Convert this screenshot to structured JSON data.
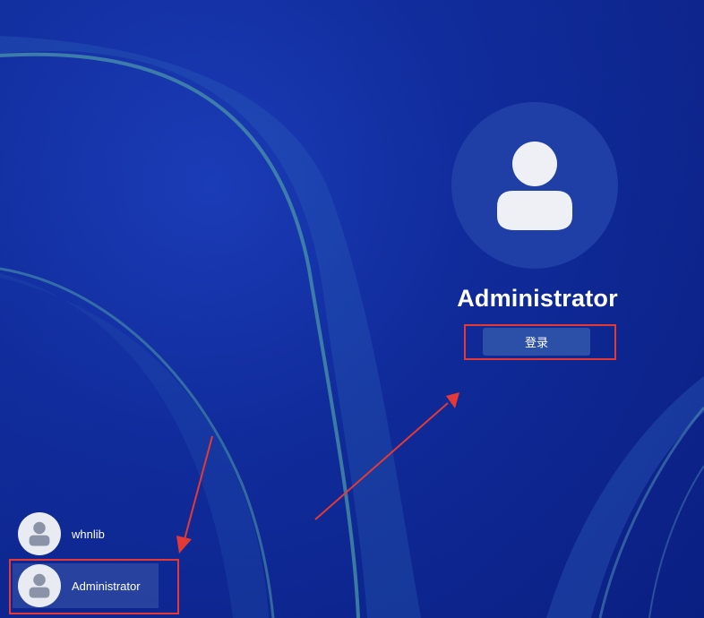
{
  "main_user": {
    "name": "Administrator",
    "login_button_label": "登录"
  },
  "user_list": [
    {
      "name": "whnlib"
    },
    {
      "name": "Administrator",
      "selected": true
    }
  ],
  "icons": {
    "main_avatar": "person-icon",
    "user_avatar": "person-icon"
  },
  "colors": {
    "background": "#0f2a9a",
    "annotation": "#e53935",
    "login_button": "#2c4fa8",
    "text": "#ffffff"
  }
}
